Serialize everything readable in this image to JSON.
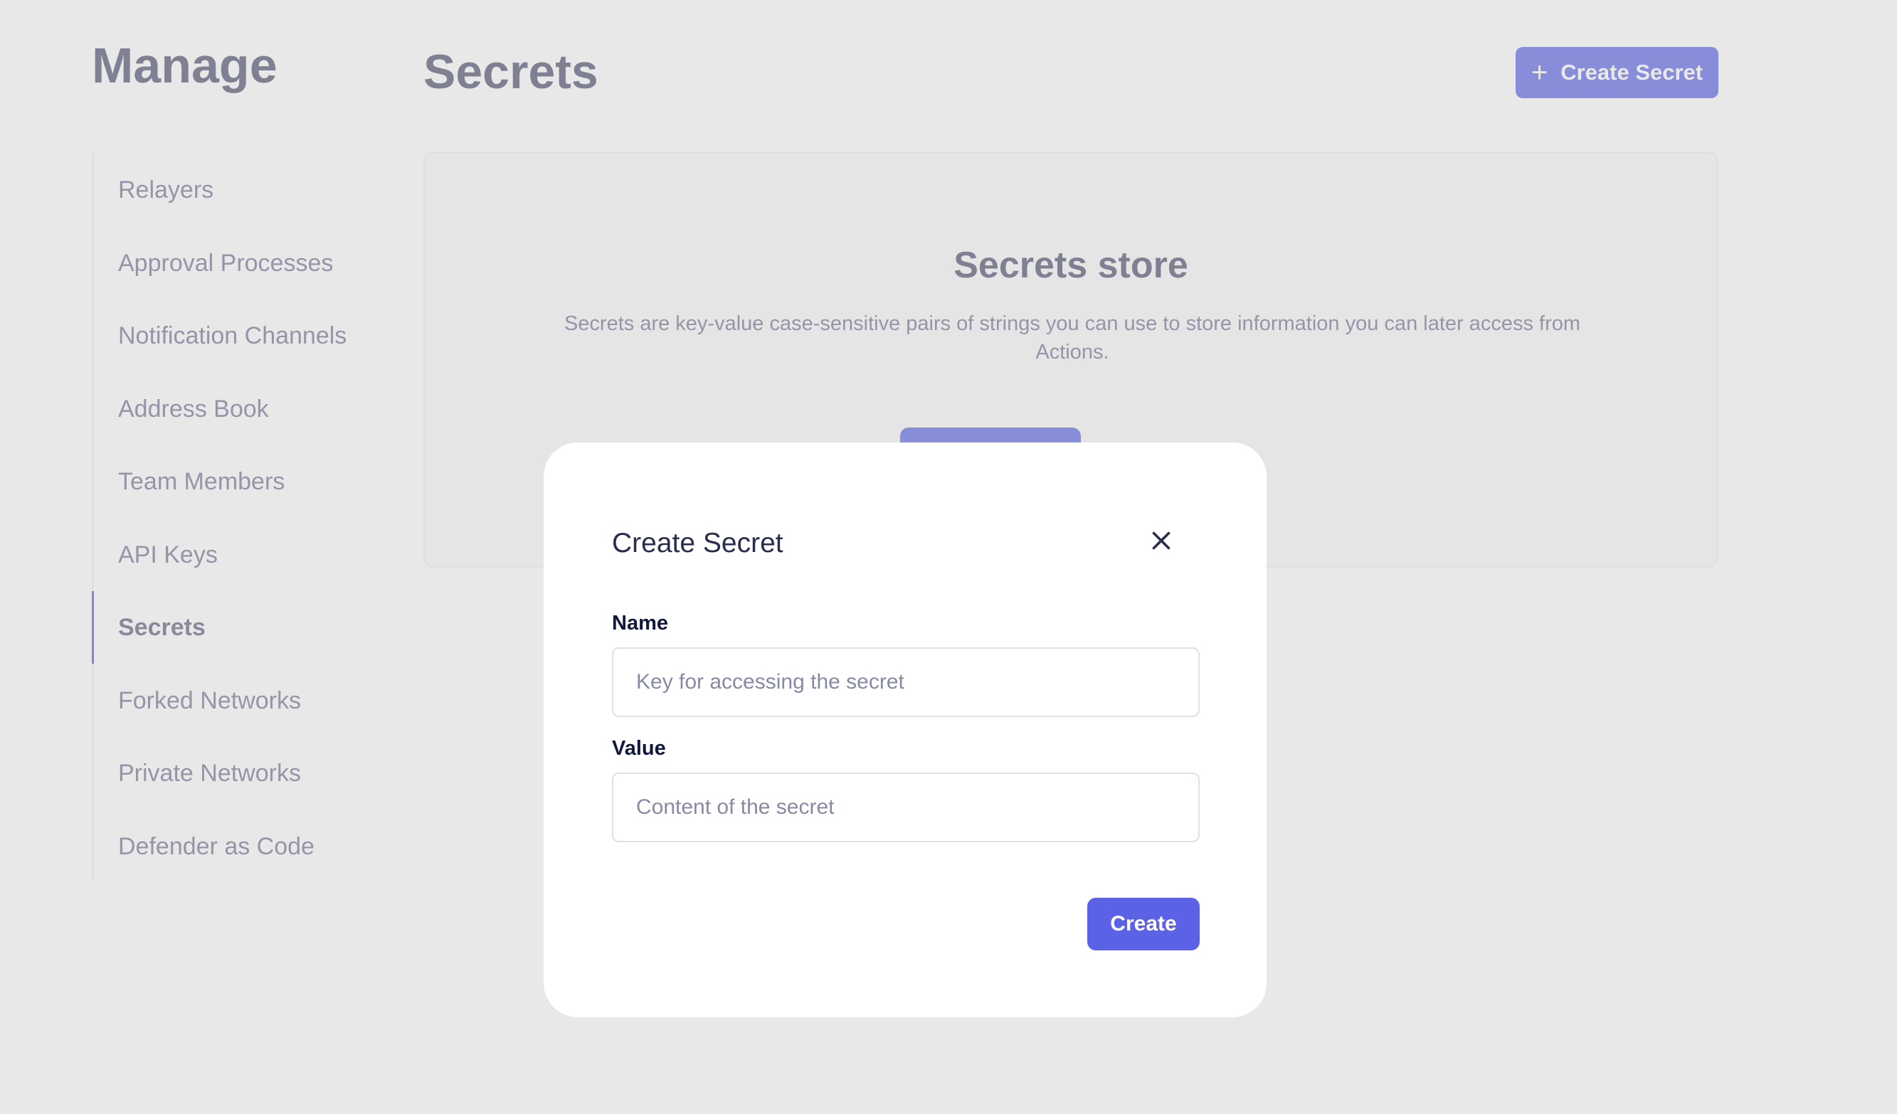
{
  "sidebar": {
    "title": "Manage",
    "items": [
      {
        "label": "Relayers"
      },
      {
        "label": "Approval Processes"
      },
      {
        "label": "Notification Channels"
      },
      {
        "label": "Address Book"
      },
      {
        "label": "Team Members"
      },
      {
        "label": "API Keys"
      },
      {
        "label": "Secrets",
        "active": true
      },
      {
        "label": "Forked Networks"
      },
      {
        "label": "Private Networks"
      },
      {
        "label": "Defender as Code"
      }
    ]
  },
  "header": {
    "title": "Secrets",
    "create_button_label": "Create Secret"
  },
  "store": {
    "title": "Secrets store",
    "description": "Secrets are key-value case-sensitive pairs of strings you can use to store information you can later access from Actions."
  },
  "modal": {
    "title": "Create Secret",
    "name_label": "Name",
    "name_placeholder": "Key for accessing the secret",
    "value_label": "Value",
    "value_placeholder": "Content of the secret",
    "submit_label": "Create"
  },
  "colors": {
    "accent": "#5b62e6",
    "text_dark": "#13173a"
  }
}
